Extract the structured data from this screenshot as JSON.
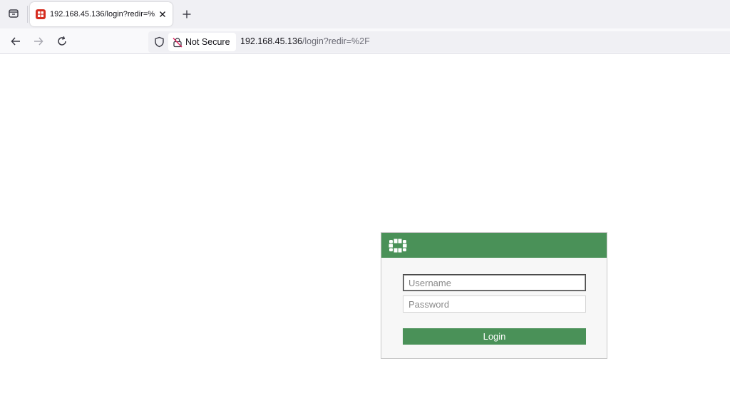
{
  "browser": {
    "tab": {
      "title": "192.168.45.136/login?redir=%2F",
      "favicon": "fortinet-favicon-icon"
    },
    "url": {
      "host": "192.168.45.136",
      "path": "/login?redir=%2F"
    },
    "security_label": "Not Secure"
  },
  "login": {
    "brand_icon": "fortinet-logo-icon",
    "username_placeholder": "Username",
    "password_placeholder": "Password",
    "button_label": "Login"
  },
  "colors": {
    "accent_green": "#4a9158",
    "favicon_red": "#d62d20"
  }
}
